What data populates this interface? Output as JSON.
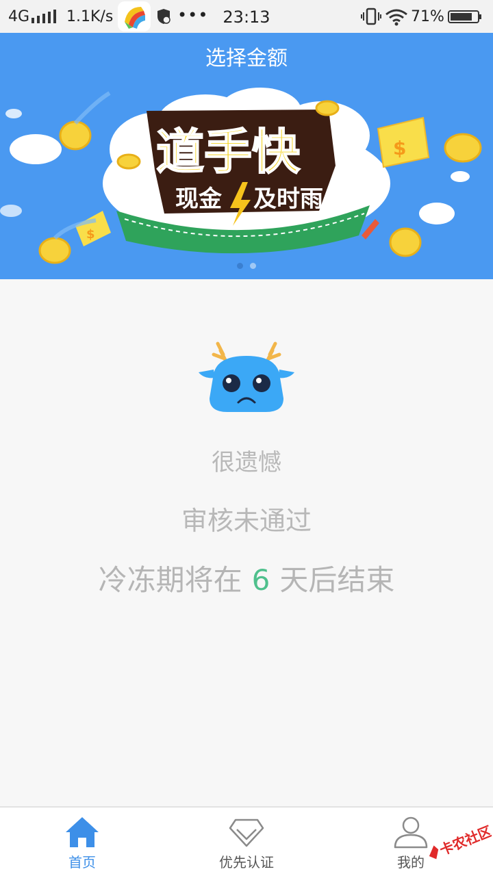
{
  "status_bar": {
    "network": "4G",
    "speed": "1.1K/s",
    "dots": "•••",
    "time": "23:13",
    "battery": "71%"
  },
  "header": {
    "title": "选择金额"
  },
  "banner": {
    "headline": "道手快",
    "tagline_left": "现金",
    "tagline_right": "及时雨",
    "slide_count": 2,
    "active_slide": 1
  },
  "result": {
    "sorry": "很遗憾",
    "review_status": "审核未通过",
    "freeze_prefix": "冷冻期将在",
    "freeze_days": "6",
    "freeze_suffix": "天后结束"
  },
  "bottom_nav": {
    "items": [
      {
        "label": "首页",
        "icon": "home-icon",
        "active": true
      },
      {
        "label": "优先认证",
        "icon": "diamond-icon",
        "active": false
      },
      {
        "label": "我的",
        "icon": "user-icon",
        "active": false
      }
    ]
  },
  "watermark": {
    "text": "卡农社区"
  },
  "colors": {
    "header_blue": "#4a99f1",
    "accent_blue": "#3d8fe8",
    "days_green": "#4fc08d",
    "text_grey": "#b8b8b8"
  }
}
